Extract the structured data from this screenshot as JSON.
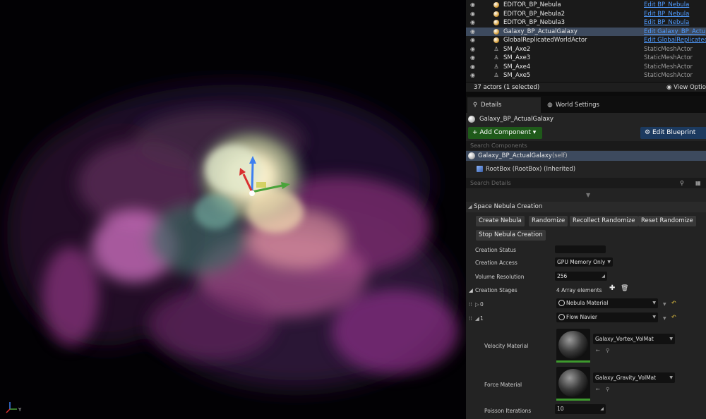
{
  "outliner": {
    "rows": [
      {
        "name": "EDITOR_BP_Nebula",
        "type": "Edit BP_Nebula",
        "kind": "bp",
        "link": true,
        "selected": false
      },
      {
        "name": "EDITOR_BP_Nebula2",
        "type": "Edit BP_Nebula",
        "kind": "bp",
        "link": true,
        "selected": false
      },
      {
        "name": "EDITOR_BP_Nebula3",
        "type": "Edit BP_Nebula",
        "kind": "bp",
        "link": true,
        "selected": false
      },
      {
        "name": "Galaxy_BP_ActualGalaxy",
        "type": "Edit Galaxy_BP_Actu",
        "kind": "bp",
        "link": true,
        "selected": true
      },
      {
        "name": "GlobalReplicatedWorldActor",
        "type": "Edit GlobalReplicated",
        "kind": "bp",
        "link": true,
        "selected": false
      },
      {
        "name": "SM_Axe2",
        "type": "StaticMeshActor",
        "kind": "sm",
        "link": false,
        "selected": false
      },
      {
        "name": "SM_Axe3",
        "type": "StaticMeshActor",
        "kind": "sm",
        "link": false,
        "selected": false
      },
      {
        "name": "SM_Axe4",
        "type": "StaticMeshActor",
        "kind": "sm",
        "link": false,
        "selected": false
      },
      {
        "name": "SM_Axe5",
        "type": "StaticMeshActor",
        "kind": "sm",
        "link": false,
        "selected": false
      }
    ],
    "count": "37 actors (1 selected)",
    "view_options": "View Optio"
  },
  "tabs": {
    "details": "Details",
    "world_settings": "World Settings",
    "close": "×"
  },
  "details": {
    "actor_name": "Galaxy_BP_ActualGalaxy",
    "add_component": "+ Add Component ▾",
    "edit_blueprint": "Edit Blueprint",
    "search_components_placeholder": "Search Components",
    "self_component": "Galaxy_BP_ActualGalaxy",
    "self_badge": "(self)",
    "root_component": "RootBox (RootBox) (Inherited)",
    "search_details_placeholder": "Search Details",
    "category": "Space Nebula Creation",
    "buttons": {
      "create": "Create Nebula",
      "randomize": "Randomize",
      "recollect": "Recollect Randomize",
      "reset": "Reset Randomize",
      "stop": "Stop Nebula Creation"
    },
    "properties": {
      "creation_status_label": "Creation Status",
      "creation_status_value": "",
      "creation_access_label": "Creation Access",
      "creation_access_value": "GPU Memory Only",
      "volume_resolution_label": "Volume Resolution",
      "volume_resolution_value": "256",
      "creation_stages_label": "Creation Stages",
      "creation_stages_value": "4 Array elements",
      "stage0_index": "0",
      "stage0_value": "Nebula Material",
      "stage1_index": "1",
      "stage1_value": "Flow Navier",
      "velocity_label": "Velocity Material",
      "velocity_value": "Galaxy_Vortex_VolMat",
      "force_label": "Force Material",
      "force_value": "Galaxy_Gravity_VolMat",
      "poisson_label": "Poisson Iterations",
      "poisson_value": "10"
    }
  },
  "icons": {
    "eye": "eye-icon",
    "search": "search-icon",
    "grid": "grid-view-icon",
    "add": "add-element-icon",
    "delete": "trash-icon",
    "reset": "reset-arrow-icon"
  },
  "colors": {
    "selection": "#3d4a5e",
    "link": "#4f9bff",
    "add_component": "#1f5a1a",
    "edit_blueprint": "#1c3a5f",
    "reset": "#e2c140"
  }
}
